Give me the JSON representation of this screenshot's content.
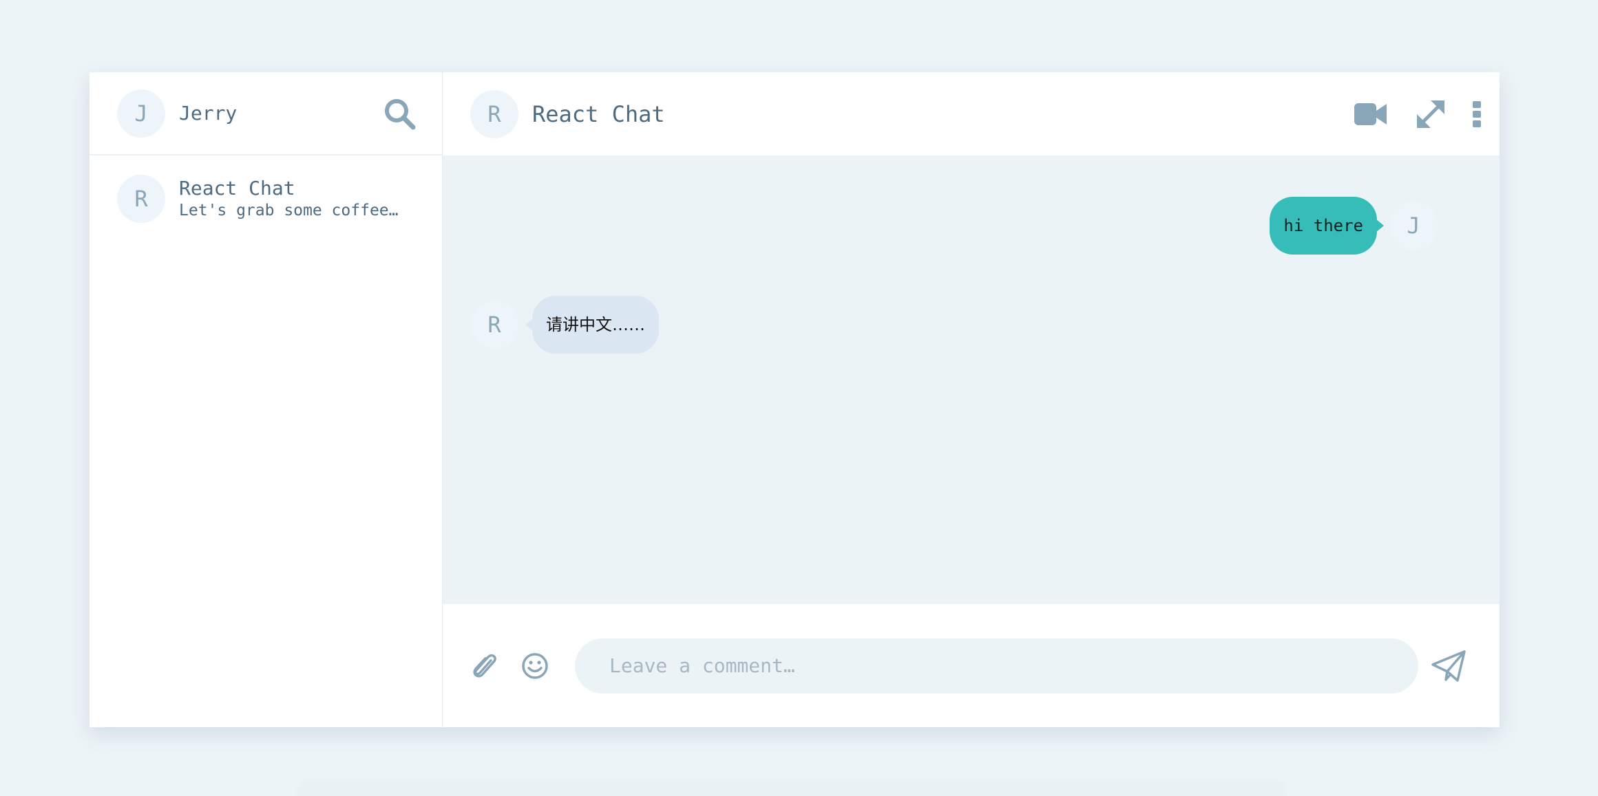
{
  "colors": {
    "background": "#edf4f8",
    "panel": "#ffffff",
    "messages_bg": "#ebf3f7",
    "accent_bubble": "#36bdb9",
    "incoming_bubble": "#dbe6f3",
    "icon": "#88a6b7",
    "text": "#4e6a80"
  },
  "sidebar": {
    "current_user": {
      "initial": "J",
      "name": "Jerry"
    },
    "search_icon": "search-icon",
    "conversations": [
      {
        "initial": "R",
        "title": "React Chat",
        "preview": "Let's grab some coffee a…"
      }
    ]
  },
  "chat": {
    "header": {
      "initial": "R",
      "title": "React Chat",
      "icons": [
        "video-camera-icon",
        "expand-icon",
        "more-vertical-icon"
      ]
    },
    "messages": [
      {
        "direction": "outgoing",
        "text": "hi there",
        "avatar": "J"
      },
      {
        "direction": "incoming",
        "text": "请讲中文……",
        "avatar": "R"
      }
    ],
    "composer": {
      "placeholder": "Leave a comment…",
      "icons": [
        "paperclip-icon",
        "smiley-icon",
        "send-icon"
      ]
    }
  }
}
